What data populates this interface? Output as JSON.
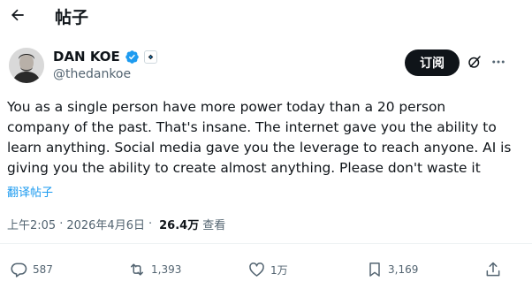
{
  "header": {
    "title": "帖子"
  },
  "author": {
    "name": "DAN KOE",
    "handle": "@thedankoe"
  },
  "buttons": {
    "subscribe": "订阅"
  },
  "post": {
    "lines": [
      "You as a single person have more power today than a 20 person",
      "company of the past. That's insane. The internet gave you the ability to",
      "learn anything. Social media gave you the leverage to reach anyone. AI is",
      "giving you the ability to create almost anything. Please don't waste it"
    ],
    "translate": "翻译帖子"
  },
  "meta": {
    "time": "上午2:05",
    "separator": "·",
    "date": "2026年4月6日",
    "views_count": "26.4万",
    "views_label": "查看"
  },
  "actions": {
    "replies": "587",
    "reposts": "1,393",
    "likes": "1万",
    "bookmarks": "3,169"
  },
  "colors": {
    "accent": "#1d9bf0",
    "text": "#0f1419",
    "secondary": "#536471"
  },
  "icons": {
    "back": "arrow-left-icon",
    "verified": "verified-badge-icon",
    "affiliation": "affiliation-badge-icon",
    "grok": "grok-icon",
    "more": "more-horizontal-icon",
    "reply": "reply-icon",
    "repost": "repost-icon",
    "like": "heart-icon",
    "bookmark": "bookmark-icon",
    "share": "share-icon"
  }
}
